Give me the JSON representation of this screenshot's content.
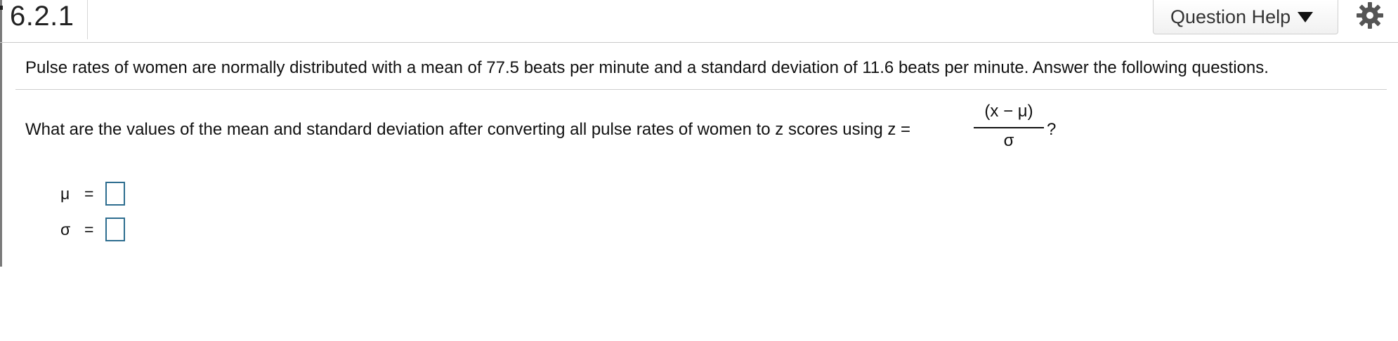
{
  "header": {
    "question_number": "6.2.1",
    "help_button_label": "Question Help",
    "settings_icon": "gear-icon"
  },
  "problem": {
    "stem": "Pulse rates of women are normally distributed with a mean of 77.5 beats per minute and a standard deviation of 11.6 beats per minute. Answer the following questions.",
    "question": "What are the values of the mean and standard deviation after converting all pulse rates of women to z scores using z =",
    "formula": {
      "numerator": "(x − μ)",
      "denominator": "σ"
    },
    "question_end": "?"
  },
  "answers": [
    {
      "symbol": "μ",
      "equals": "=",
      "value": ""
    },
    {
      "symbol": "σ",
      "equals": "=",
      "value": ""
    }
  ],
  "colors": {
    "answer_box_border": "#2d6d8f",
    "divider": "#cfcfcf"
  }
}
